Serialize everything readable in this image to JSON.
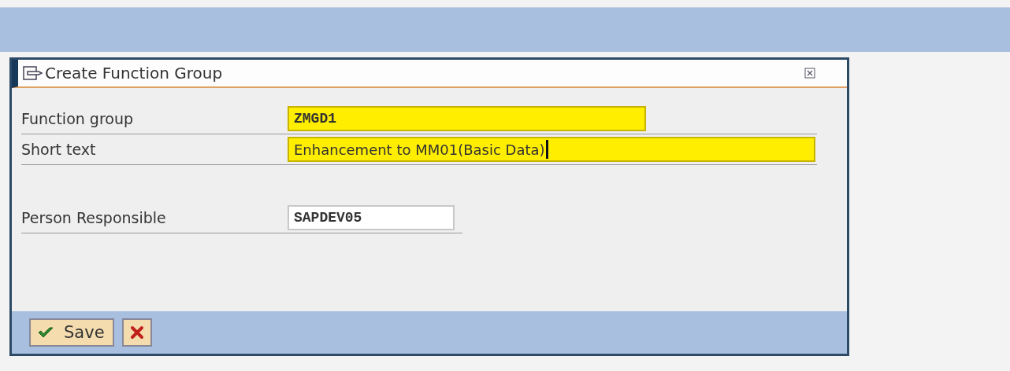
{
  "dialog": {
    "title": "Create Function Group",
    "fields": [
      {
        "label": "Function group",
        "value": "ZMGD1",
        "required": true,
        "focused": false
      },
      {
        "label": "Short text",
        "value": "Enhancement to MM01(Basic Data)",
        "required": true,
        "focused": true
      },
      {
        "label": "Person Responsible",
        "value": "SAPDEV05",
        "required": false,
        "focused": false
      }
    ],
    "buttons": [
      {
        "kind": "save",
        "label": "Save"
      },
      {
        "kind": "cancel"
      }
    ]
  }
}
